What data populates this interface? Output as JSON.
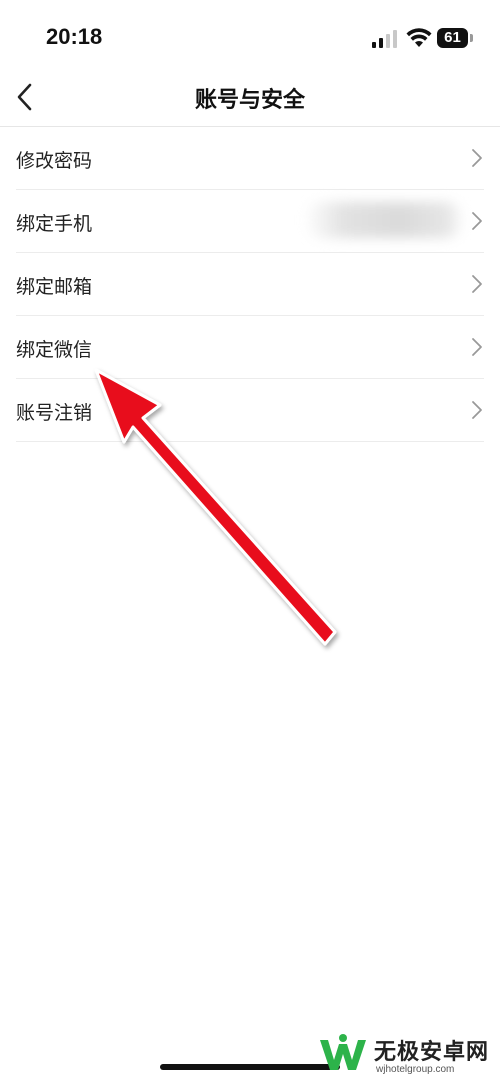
{
  "status_bar": {
    "time": "20:18",
    "battery_level": "61",
    "icons": [
      "signal-icon",
      "wifi-icon",
      "battery-icon"
    ]
  },
  "nav": {
    "title": "账号与安全",
    "back_icon": "chevron-left-icon"
  },
  "menu": {
    "items": [
      {
        "label": "修改密码"
      },
      {
        "label": "绑定手机"
      },
      {
        "label": "绑定邮箱"
      },
      {
        "label": "绑定微信"
      },
      {
        "label": "账号注销"
      }
    ],
    "chevron_icon": "chevron-right-icon"
  },
  "annotation": {
    "arrow_color": "#e8101a",
    "points_to": "绑定微信"
  },
  "watermark": {
    "title": "无极安卓网",
    "url": "wjhotelgroup.com",
    "logo_color": "#2db34a"
  }
}
